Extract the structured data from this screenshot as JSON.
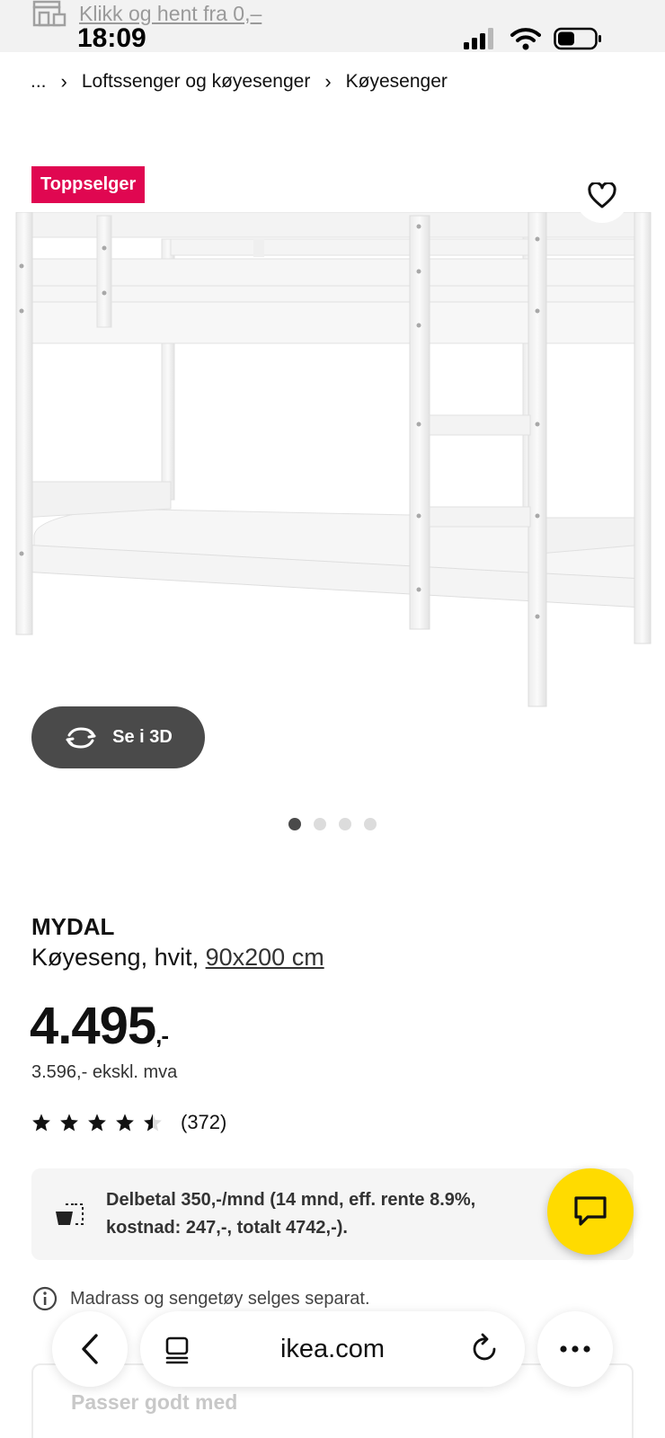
{
  "status_bar": {
    "promo_text": "Klikk og hent fra 0,–",
    "time": "18:09"
  },
  "breadcrumb": {
    "items": [
      "...",
      "Loftssenger og køyesenger",
      "Køyesenger"
    ]
  },
  "product": {
    "badge": "Toppselger",
    "view_3d_label": "Se i 3D",
    "image_count": 4,
    "active_image": 1,
    "name": "MYDAL",
    "description": "Køyeseng, hvit,",
    "size": "90x200 cm",
    "price_main": "4.495",
    "price_suffix": ",-",
    "price_ex_vat": "3.596,- ekskl. mva",
    "rating_value": 4.5,
    "rating_max": 5,
    "review_count": "(372)"
  },
  "financing": {
    "text": "Delbetal 350,-/mnd (14 mnd, eff. rente 8.9%, kostnad: 247,-, totalt 4742,-)."
  },
  "notice": {
    "text": "Madrass og sengetøy selges separat."
  },
  "related": {
    "title": "Passer godt med"
  },
  "browser": {
    "url": "ikea.com"
  },
  "colors": {
    "badge": "#e00751",
    "chat_button": "#ffdb00",
    "button_3d": "#4a4a4a"
  }
}
